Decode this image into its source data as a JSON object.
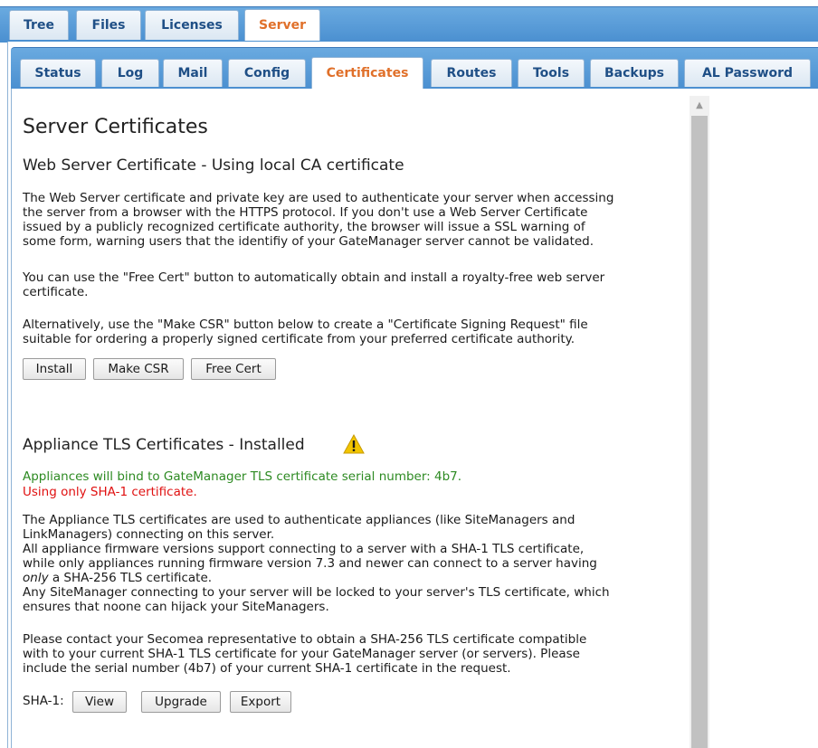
{
  "top_tabs": [
    {
      "label": "Tree"
    },
    {
      "label": "Files"
    },
    {
      "label": "Licenses"
    },
    {
      "label": "Server",
      "active": true
    }
  ],
  "sub_tabs": [
    {
      "label": "Status"
    },
    {
      "label": "Log"
    },
    {
      "label": "Mail"
    },
    {
      "label": "Config"
    },
    {
      "label": "Certificates",
      "active": true
    },
    {
      "label": "Routes"
    },
    {
      "label": "Tools"
    },
    {
      "label": "Backups"
    },
    {
      "label": "AL Password"
    }
  ],
  "page": {
    "title": "Server Certificates"
  },
  "web_cert": {
    "heading": "Web Server Certificate - Using local CA certificate",
    "para1_lines": [
      "The Web Server certificate and private key are used to authenticate your server when accessing",
      "the server from a browser with the HTTPS protocol. If you don't use a Web Server Certificate",
      "issued by a publicly recognized certificate authority, the browser will issue a SSL warning of",
      "some form, warning users that the identifiy of your GateManager server cannot be validated."
    ],
    "para2_lines": [
      "You can use the \"Free Cert\" button to automatically obtain and install a royalty-free web server",
      "certificate."
    ],
    "para3_lines": [
      "Alternatively, use the \"Make CSR\" button below to create a \"Certificate Signing Request\" file",
      "suitable for ordering a properly signed certificate from your preferred certificate authority."
    ],
    "install_label": "Install",
    "make_csr_label": "Make CSR",
    "free_cert_label": "Free Cert"
  },
  "appliance": {
    "heading": "Appliance TLS Certificates - Installed",
    "status_green": "Appliances will bind to GateManager TLS certificate serial number: 4b7.",
    "status_red": "Using only SHA-1 certificate.",
    "para1_lines": [
      "The Appliance TLS certificates are used to authenticate appliances (like SiteManagers and",
      "LinkManagers) connecting on this server.",
      "All appliance firmware versions support connecting to a server with a SHA-1 TLS certificate,",
      "while only appliances running firmware version 7.3 and newer can connect to a server having"
    ],
    "para1_only_word": "only",
    "para1_only_rest": " a SHA-256 TLS certificate.",
    "para1_tail_lines": [
      "Any SiteManager connecting to your server will be locked to your server's TLS certificate, which",
      "ensures that noone can hijack your SiteManagers."
    ],
    "para2_lines": [
      "Please contact your Secomea representative to obtain a SHA-256 TLS certificate compatible",
      "with to your current SHA-1 TLS certificate for your GateManager server (or servers). Please",
      "include the serial number (4b7) of your current SHA-1 certificate in the request."
    ],
    "sha1_label": "SHA-1:",
    "view_label": "View",
    "upgrade_label": "Upgrade",
    "export_label": "Export"
  },
  "colors": {
    "tab_active_text": "#e0702a",
    "tab_text": "#1f4f86",
    "tab_bar": "#4a8fd0",
    "status_ok": "#2d8a22",
    "status_warn": "#e01010",
    "warning_icon": "#f2c500"
  },
  "icons": {
    "warning": "warning-triangle-icon",
    "scroll_up": "scroll-up-arrow-icon"
  }
}
